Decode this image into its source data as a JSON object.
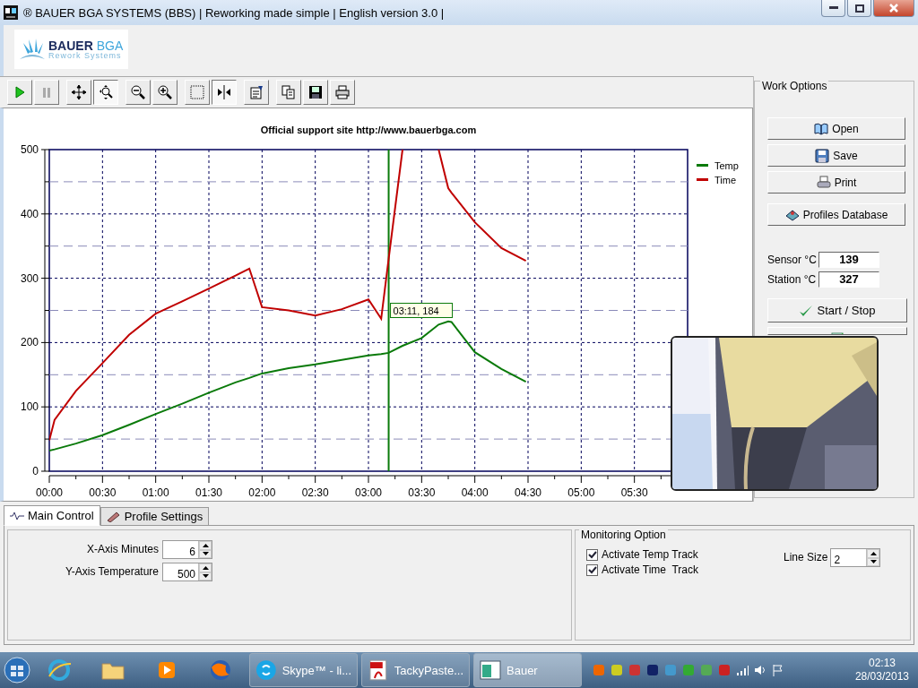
{
  "window": {
    "title": "® BAUER BGA SYSTEMS (BBS) | Reworking made simple | English version 3.0 |"
  },
  "logo": {
    "brand": "BAUER",
    "brand_accent": "BGA",
    "tagline": "Rework Systems"
  },
  "toolbar": {
    "groups": [
      [
        {
          "kind": "play",
          "pressed": false
        },
        {
          "kind": "pause",
          "pressed": false
        }
      ],
      [
        {
          "kind": "move",
          "pressed": false
        },
        {
          "kind": "zoom-area",
          "pressed": true
        }
      ],
      [
        {
          "kind": "zoom-out",
          "pressed": false
        },
        {
          "kind": "zoom-in",
          "pressed": false
        }
      ],
      [
        {
          "kind": "select",
          "pressed": false
        },
        {
          "kind": "cursor",
          "pressed": true
        }
      ],
      [
        {
          "kind": "properties",
          "pressed": false
        }
      ],
      [
        {
          "kind": "copy",
          "pressed": false
        },
        {
          "kind": "save",
          "pressed": false
        },
        {
          "kind": "print",
          "pressed": false
        }
      ]
    ]
  },
  "chart": {
    "chart_data": {
      "type": "line",
      "title": "Official support site http://www.bauerbga.com",
      "x": [
        0,
        0.05,
        0.25,
        0.5,
        0.75,
        1,
        1.25,
        1.5,
        1.75,
        1.88,
        2,
        2.25,
        2.5,
        2.75,
        3,
        3.12,
        3.19,
        3.32,
        3.5,
        3.66,
        3.75,
        3.78,
        4,
        4.25,
        4.48
      ],
      "series": [
        {
          "name": "Temp",
          "color": "#0a7a0a",
          "values": [
            32,
            34,
            43,
            56,
            72,
            89,
            105,
            122,
            138,
            145,
            152,
            160,
            166,
            173,
            180,
            182,
            184,
            195,
            207,
            228,
            233,
            232,
            185,
            159,
            139
          ]
        },
        {
          "name": "Time",
          "color": "#c00000",
          "values": [
            48,
            80,
            125,
            168,
            212,
            245,
            264,
            284,
            304,
            315,
            255,
            250,
            242,
            252,
            267,
            237,
            330,
            500,
            null,
            500,
            440,
            433,
            387,
            347,
            327
          ]
        }
      ],
      "xlim": [
        0,
        6
      ],
      "ylim": [
        0,
        500
      ],
      "xticks": [
        {
          "value": 0,
          "label": "00:00"
        },
        {
          "value": 0.5,
          "label": "00:30"
        },
        {
          "value": 1,
          "label": "01:00"
        },
        {
          "value": 1.5,
          "label": "01:30"
        },
        {
          "value": 2,
          "label": "02:00"
        },
        {
          "value": 2.5,
          "label": "02:30"
        },
        {
          "value": 3,
          "label": "03:00"
        },
        {
          "value": 3.5,
          "label": "03:30"
        },
        {
          "value": 4,
          "label": "04:00"
        },
        {
          "value": 4.5,
          "label": "04:30"
        },
        {
          "value": 5,
          "label": "05:00"
        },
        {
          "value": 5.5,
          "label": "05:30"
        }
      ],
      "yticks": [
        0,
        100,
        200,
        300,
        400,
        500
      ],
      "grid": true,
      "legend": true,
      "ref_lines": [
        {
          "axis": "y",
          "value": 50,
          "color": "#8a8ab8"
        },
        {
          "axis": "y",
          "value": 150,
          "color": "#8a8ab8"
        },
        {
          "axis": "y",
          "value": 250,
          "color": "#8a8ab8"
        },
        {
          "axis": "y",
          "value": 350,
          "color": "#8a8ab8"
        },
        {
          "axis": "y",
          "value": 450,
          "color": "#8a8ab8"
        },
        {
          "axis": "x",
          "value": 3.19,
          "color": "#0a7a0a"
        }
      ],
      "annotations": [
        {
          "x": 3.19,
          "y": 250,
          "text": "03:11, 184"
        }
      ]
    }
  },
  "work_options": {
    "title": "Work Options",
    "buttons": [
      {
        "kind": "open",
        "label": "Open"
      },
      {
        "kind": "save",
        "label": "Save"
      },
      {
        "kind": "print",
        "label": "Print"
      },
      {
        "kind": "database",
        "label": "Profiles Database"
      }
    ],
    "readings": [
      {
        "label": "Sensor °C",
        "value": "139"
      },
      {
        "label": "Station °C",
        "value": "327"
      }
    ],
    "actions": [
      {
        "kind": "start",
        "label": "Start / Stop"
      },
      {
        "kind": "covered"
      }
    ]
  },
  "tabs": [
    {
      "kind": "control",
      "label": "Main Control",
      "selected": true
    },
    {
      "kind": "profile",
      "label": "Profile Settings",
      "selected": false
    }
  ],
  "axis_settings": [
    {
      "label": "X-Axis Minutes",
      "value": "6"
    },
    {
      "label": "Y-Axis Temperature",
      "value": "500"
    }
  ],
  "monitoring": {
    "title": "Monitoring Option",
    "options": [
      {
        "label": "Activate Temp Track",
        "checked": true
      },
      {
        "label": "Activate Time  Track",
        "checked": true
      }
    ],
    "line_size": {
      "label": "Line Size",
      "value": "2"
    }
  },
  "taskbar": {
    "tasks": [
      {
        "kind": "skype",
        "label": "Skype™ - li...",
        "active": false
      },
      {
        "kind": "pdf",
        "label": "TackyPaste...",
        "active": false
      },
      {
        "kind": "app",
        "label": "Bauer",
        "active": true
      }
    ],
    "clock": {
      "time": "02:13",
      "date": "28/03/2013"
    }
  }
}
